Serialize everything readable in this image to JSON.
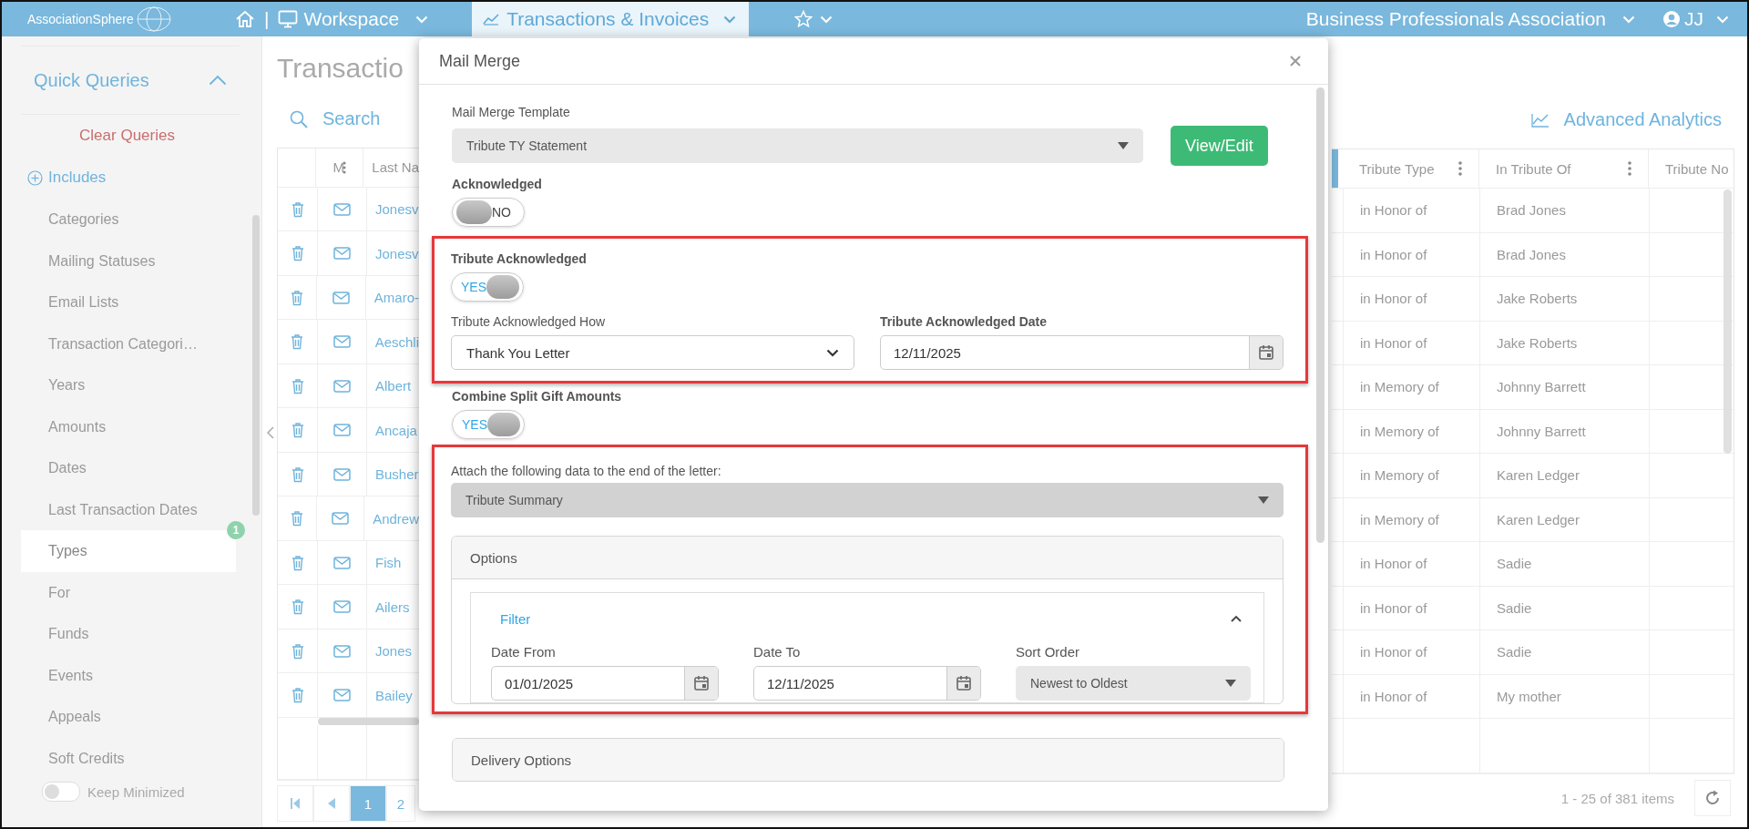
{
  "topbar": {
    "logo": "AssociationSphere",
    "separator": "|",
    "workspace": "Workspace",
    "module_tab": "Transactions & Invoices",
    "organization": "Business Professionals Association",
    "user": "JJ"
  },
  "sidebar": {
    "title": "Quick Queries",
    "expanded": true,
    "clear": "Clear Queries",
    "includes": "Includes",
    "items": [
      {
        "label": "Categories",
        "selected": false
      },
      {
        "label": "Mailing Statuses",
        "selected": false
      },
      {
        "label": "Email Lists",
        "selected": false
      },
      {
        "label": "Transaction Categori…",
        "selected": false
      },
      {
        "label": "Years",
        "selected": false
      },
      {
        "label": "Amounts",
        "selected": false
      },
      {
        "label": "Dates",
        "selected": false
      },
      {
        "label": "Last Transaction Dates",
        "selected": false
      },
      {
        "label": "Types",
        "selected": true,
        "badge": "1"
      },
      {
        "label": "For",
        "selected": false
      },
      {
        "label": "Funds",
        "selected": false
      },
      {
        "label": "Events",
        "selected": false
      },
      {
        "label": "Appeals",
        "selected": false
      },
      {
        "label": "Soft Credits",
        "selected": false
      }
    ],
    "keep_minimized": {
      "label": "Keep Minimized",
      "on": false
    }
  },
  "page": {
    "title": "Transactio",
    "search": "Search",
    "analytics": "Advanced Analytics"
  },
  "table": {
    "left_columns": [
      "M",
      "Last Na"
    ],
    "right_columns": [
      "Tribute Type",
      "In Tribute Of",
      "Tribute No"
    ],
    "rows": [
      {
        "last_name": "Jonesv",
        "tribute_type": "in Honor of",
        "in_tribute_of": "Brad Jones"
      },
      {
        "last_name": "Jonesv",
        "tribute_type": "in Honor of",
        "in_tribute_of": "Brad Jones"
      },
      {
        "last_name": "Amaro-",
        "tribute_type": "in Honor of",
        "in_tribute_of": "Jake Roberts"
      },
      {
        "last_name": "Aeschli",
        "tribute_type": "in Honor of",
        "in_tribute_of": "Jake Roberts"
      },
      {
        "last_name": "Albert",
        "tribute_type": "in Memory of",
        "in_tribute_of": "Johnny Barrett"
      },
      {
        "last_name": "Ancaja",
        "tribute_type": "in Memory of",
        "in_tribute_of": "Johnny Barrett"
      },
      {
        "last_name": "Busher",
        "tribute_type": "in Memory of",
        "in_tribute_of": "Karen Ledger"
      },
      {
        "last_name": "Andrew",
        "tribute_type": "in Memory of",
        "in_tribute_of": "Karen Ledger"
      },
      {
        "last_name": "Fish",
        "tribute_type": "in Honor of",
        "in_tribute_of": "Sadie"
      },
      {
        "last_name": "Ailers",
        "tribute_type": "in Honor of",
        "in_tribute_of": "Sadie"
      },
      {
        "last_name": "Jones",
        "tribute_type": "in Honor of",
        "in_tribute_of": "Sadie"
      },
      {
        "last_name": "Bailey",
        "tribute_type": "in Honor of",
        "in_tribute_of": "My mother"
      }
    ]
  },
  "pager": {
    "pages": [
      {
        "label": "1",
        "selected": true
      },
      {
        "label": "2",
        "selected": false
      }
    ],
    "summary": "1 - 25 of 381 items"
  },
  "modal": {
    "title": "Mail Merge",
    "template": {
      "label": "Mail Merge Template",
      "value": "Tribute TY Statement",
      "button": "View/Edit"
    },
    "acknowledged": {
      "label": "Acknowledged",
      "on": false,
      "text": "NO"
    },
    "tribute_section": {
      "toggle": {
        "label": "Tribute Acknowledged",
        "on": true,
        "text": "YES"
      },
      "how": {
        "label": "Tribute Acknowledged How",
        "value": "Thank You Letter"
      },
      "date": {
        "label": "Tribute Acknowledged Date",
        "value": "12/11/2025"
      }
    },
    "combine": {
      "label": "Combine Split Gift Amounts",
      "on": true,
      "text": "YES"
    },
    "attach_section": {
      "label": "Attach the following data to the end of the letter:",
      "value": "Tribute Summary",
      "options": {
        "title": "Options",
        "filter": {
          "title": "Filter",
          "expanded": true,
          "date_from": {
            "label": "Date From",
            "value": "01/01/2025"
          },
          "date_to": {
            "label": "Date To",
            "value": "12/11/2025"
          },
          "sort_order": {
            "label": "Sort Order",
            "value": "Newest to Oldest"
          }
        }
      }
    },
    "delivery": {
      "title": "Delivery Options"
    }
  }
}
